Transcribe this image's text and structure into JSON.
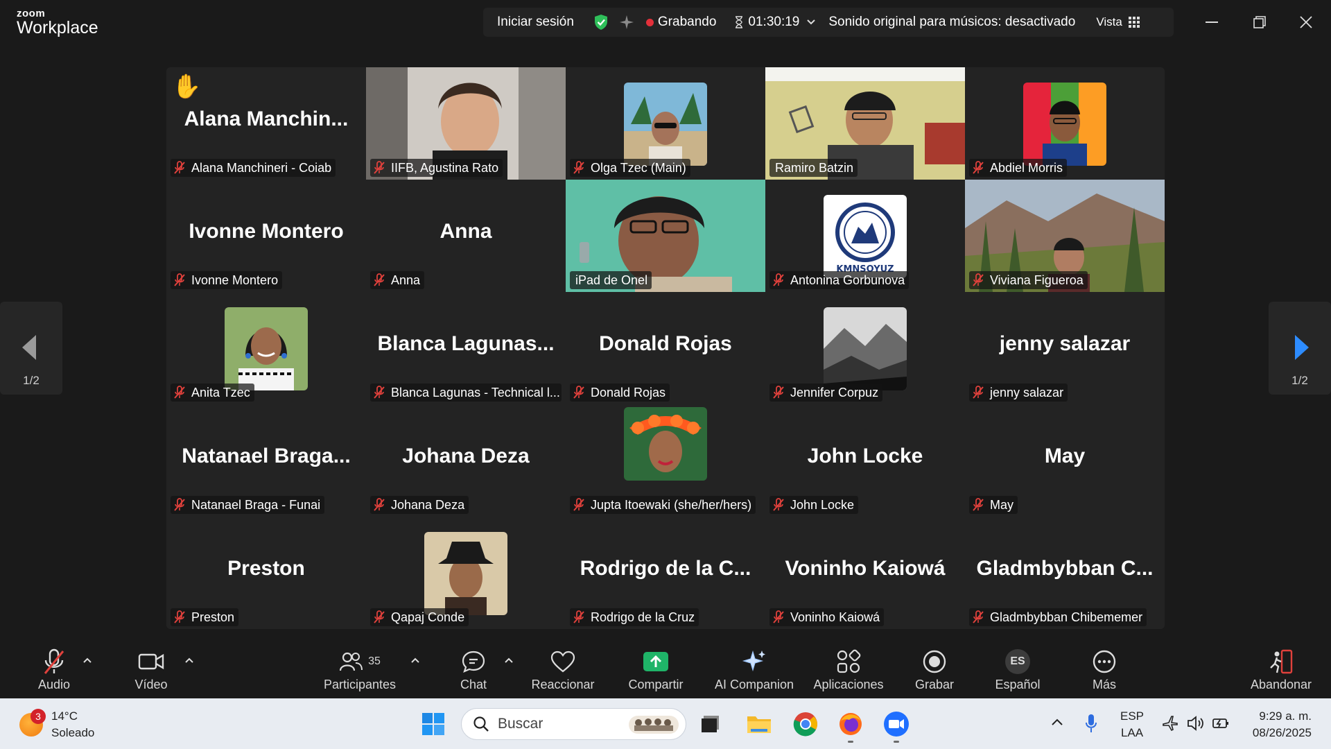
{
  "app": {
    "logo_small": "zoom",
    "logo_big": "Workplace"
  },
  "topbar": {
    "signin": "Iniciar sesión",
    "recording": "Grabando",
    "timer": "01:30:19",
    "sound": "Sonido original para músicos: desactivado",
    "view": "Vista"
  },
  "gallery": {
    "page_left": "1/2",
    "page_right": "1/2",
    "tiles": [
      {
        "label": "Alana Manchineri - Coiab",
        "big": "Alana  Manchin...",
        "hand": "✋"
      },
      {
        "label": "IIFB, Agustina Rato"
      },
      {
        "label": "Olga Tzec (Main)"
      },
      {
        "label": "Ramiro Batzin"
      },
      {
        "label": "Abdiel Morris"
      },
      {
        "label": "Ivonne Montero",
        "big": "Ivonne Montero"
      },
      {
        "label": "Anna",
        "big": "Anna"
      },
      {
        "label": "iPad de Onel"
      },
      {
        "label": "Antonina Gorbunova",
        "logo_text": "KMNSOYUZ"
      },
      {
        "label": "Viviana Figueroa"
      },
      {
        "label": "Anita Tzec"
      },
      {
        "label": "Blanca Lagunas - Technical l...",
        "big": "Blanca  Lagunas..."
      },
      {
        "label": "Donald Rojas",
        "big": "Donald Rojas"
      },
      {
        "label": "Jennifer Corpuz"
      },
      {
        "label": "jenny salazar",
        "big": "jenny salazar"
      },
      {
        "label": "Natanael Braga - Funai",
        "big": "Natanael  Braga..."
      },
      {
        "label": "Johana Deza",
        "big": "Johana Deza"
      },
      {
        "label": "Jupta Itoewaki (she/her/hers)"
      },
      {
        "label": "John Locke",
        "big": "John Locke"
      },
      {
        "label": "May",
        "big": "May"
      },
      {
        "label": "Preston",
        "big": "Preston"
      },
      {
        "label": "Qapaj Conde"
      },
      {
        "label": "Rodrigo de la Cruz",
        "big": "Rodrigo de la C..."
      },
      {
        "label": "Voninho Kaiowá",
        "big": "Voninho Kaiowá"
      },
      {
        "label": "Gladmbybban Chibememer",
        "big": "Gladmbybban  C..."
      }
    ]
  },
  "toolbar": {
    "audio": "Audio",
    "video": "Vídeo",
    "participants": "Participantes",
    "participants_count": "35",
    "chat": "Chat",
    "react": "Reaccionar",
    "share": "Compartir",
    "companion": "AI Companion",
    "apps": "Aplicaciones",
    "record": "Grabar",
    "language": "Español",
    "language_code": "ES",
    "more": "Más",
    "leave": "Abandonar"
  },
  "taskbar": {
    "weather_badge": "3",
    "temperature": "14°C",
    "condition": "Soleado",
    "search_placeholder": "Buscar",
    "lang_top": "ESP",
    "lang_bottom": "LAA",
    "time": "9:29 a. m.",
    "date": "08/26/2025"
  },
  "colors": {
    "accent_green": "#2ecc71",
    "record_red": "#e3303a",
    "share_green": "#1fb468",
    "nav_blue": "#2d8cff"
  }
}
